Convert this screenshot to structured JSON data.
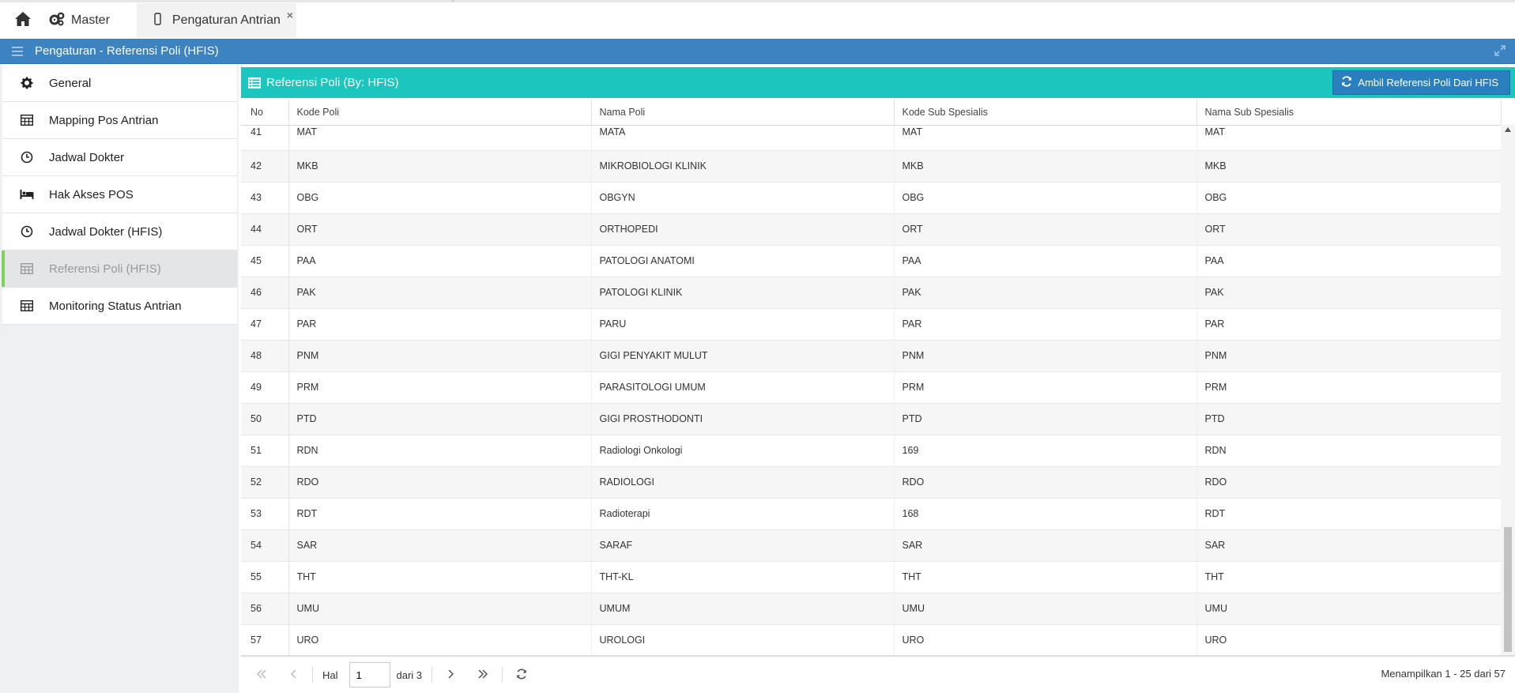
{
  "tabs": {
    "master": "Master",
    "active": "Pengaturan Antrian",
    "close": "×"
  },
  "header": {
    "title": "Pengaturan - Referensi Poli (HFIS)"
  },
  "sidebar": {
    "items": [
      {
        "label": "General",
        "icon": "gear-icon"
      },
      {
        "label": "Mapping Pos Antrian",
        "icon": "table-icon"
      },
      {
        "label": "Jadwal Dokter",
        "icon": "clock-icon"
      },
      {
        "label": "Hak Akses POS",
        "icon": "bed-icon"
      },
      {
        "label": "Jadwal Dokter (HFIS)",
        "icon": "clock-icon"
      },
      {
        "label": "Referensi Poli (HFIS)",
        "icon": "table-icon",
        "active": true
      },
      {
        "label": "Monitoring Status Antrian",
        "icon": "table-icon"
      }
    ]
  },
  "grid": {
    "title": "Referensi Poli (By: HFIS)",
    "fetch_button": "Ambil Referensi Poli Dari HFIS",
    "columns": [
      "No",
      "Kode Poli",
      "Nama Poli",
      "Kode Sub Spesialis",
      "Nama Sub Spesialis"
    ],
    "rows": [
      [
        "41",
        "MAT",
        "MATA",
        "MAT",
        "MAT"
      ],
      [
        "42",
        "MKB",
        "MIKROBIOLOGI KLINIK",
        "MKB",
        "MKB"
      ],
      [
        "43",
        "OBG",
        "OBGYN",
        "OBG",
        "OBG"
      ],
      [
        "44",
        "ORT",
        "ORTHOPEDI",
        "ORT",
        "ORT"
      ],
      [
        "45",
        "PAA",
        "PATOLOGI ANATOMI",
        "PAA",
        "PAA"
      ],
      [
        "46",
        "PAK",
        "PATOLOGI KLINIK",
        "PAK",
        "PAK"
      ],
      [
        "47",
        "PAR",
        "PARU",
        "PAR",
        "PAR"
      ],
      [
        "48",
        "PNM",
        "GIGI PENYAKIT MULUT",
        "PNM",
        "PNM"
      ],
      [
        "49",
        "PRM",
        "PARASITOLOGI UMUM",
        "PRM",
        "PRM"
      ],
      [
        "50",
        "PTD",
        "GIGI PROSTHODONTI",
        "PTD",
        "PTD"
      ],
      [
        "51",
        "RDN",
        "Radiologi Onkologi",
        "169",
        "RDN"
      ],
      [
        "52",
        "RDO",
        "RADIOLOGI",
        "RDO",
        "RDO"
      ],
      [
        "53",
        "RDT",
        "Radioterapi",
        "168",
        "RDT"
      ],
      [
        "54",
        "SAR",
        "SARAF",
        "SAR",
        "SAR"
      ],
      [
        "55",
        "THT",
        "THT-KL",
        "THT",
        "THT"
      ],
      [
        "56",
        "UMU",
        "UMUM",
        "UMU",
        "UMU"
      ],
      [
        "57",
        "URO",
        "UROLOGI",
        "URO",
        "URO"
      ]
    ]
  },
  "pager": {
    "page_label": "Hal",
    "page_value": "1",
    "of_label": "dari 3",
    "summary": "Menampilkan 1 - 25 dari 57"
  },
  "colors": {
    "header_blue": "#3c83c1",
    "grid_teal": "#1cc6bf",
    "active_indicator": "#7cd35f"
  }
}
